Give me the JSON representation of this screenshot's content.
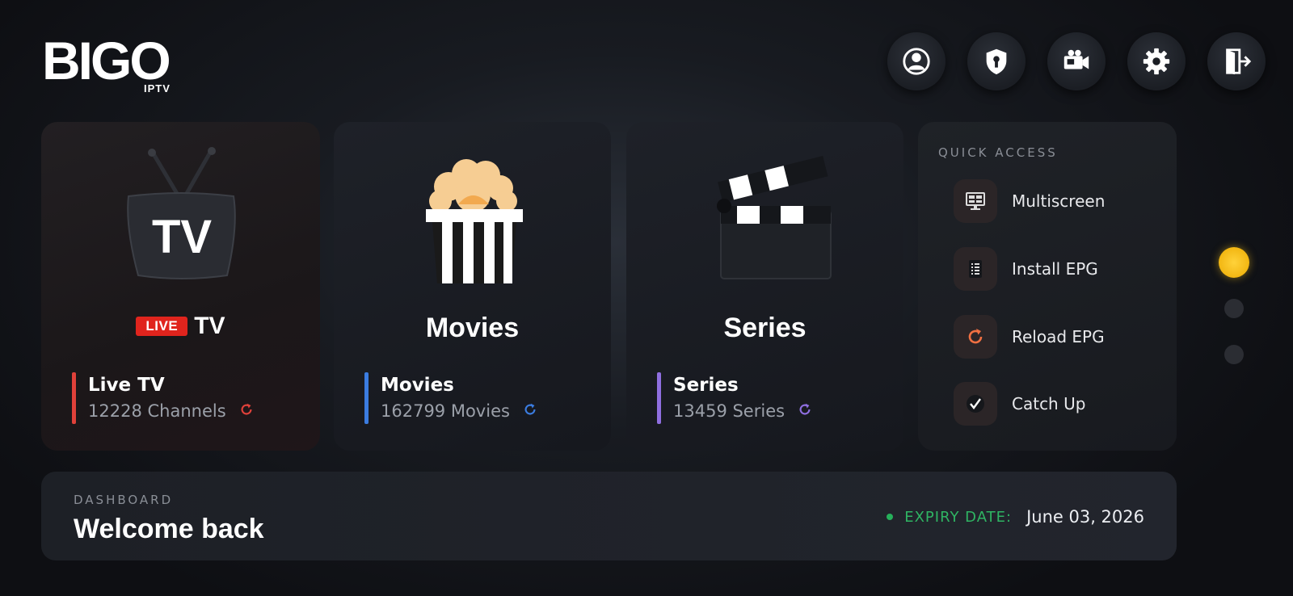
{
  "logo": {
    "main": "BIGO",
    "sub": "IPTV"
  },
  "top_actions": [
    {
      "name": "profile-icon"
    },
    {
      "name": "vpn-shield-icon"
    },
    {
      "name": "video-camera-icon"
    },
    {
      "name": "gear-icon"
    },
    {
      "name": "logout-icon"
    }
  ],
  "cards": {
    "live": {
      "badge": "LIVE",
      "title_word": "TV",
      "name": "Live TV",
      "count": "12228 Channels",
      "accent": "#e0413a",
      "icon": "tv-icon"
    },
    "movies": {
      "title": "Movies",
      "name": "Movies",
      "count": "162799 Movies",
      "accent": "#3b7ce0",
      "icon": "popcorn-icon"
    },
    "series": {
      "title": "Series",
      "name": "Series",
      "count": "13459 Series",
      "accent": "#8f6fe0",
      "icon": "clapperboard-icon"
    }
  },
  "quick_access": {
    "title": "QUICK ACCESS",
    "items": [
      {
        "label": "Multiscreen",
        "icon": "multiscreen-icon"
      },
      {
        "label": "Install EPG",
        "icon": "epg-list-icon"
      },
      {
        "label": "Reload EPG",
        "icon": "reload-icon",
        "accent": "#f07042"
      },
      {
        "label": "Catch Up",
        "icon": "checkmark-icon"
      }
    ]
  },
  "pager": {
    "active_color": "#f5c31c",
    "inactive_color": "#2b2d33"
  },
  "dashboard": {
    "label": "DASHBOARD",
    "welcome": "Welcome back",
    "expiry_label": "EXPIRY DATE:",
    "expiry_value": "June 03, 2026",
    "expiry_color": "#2fb463"
  }
}
